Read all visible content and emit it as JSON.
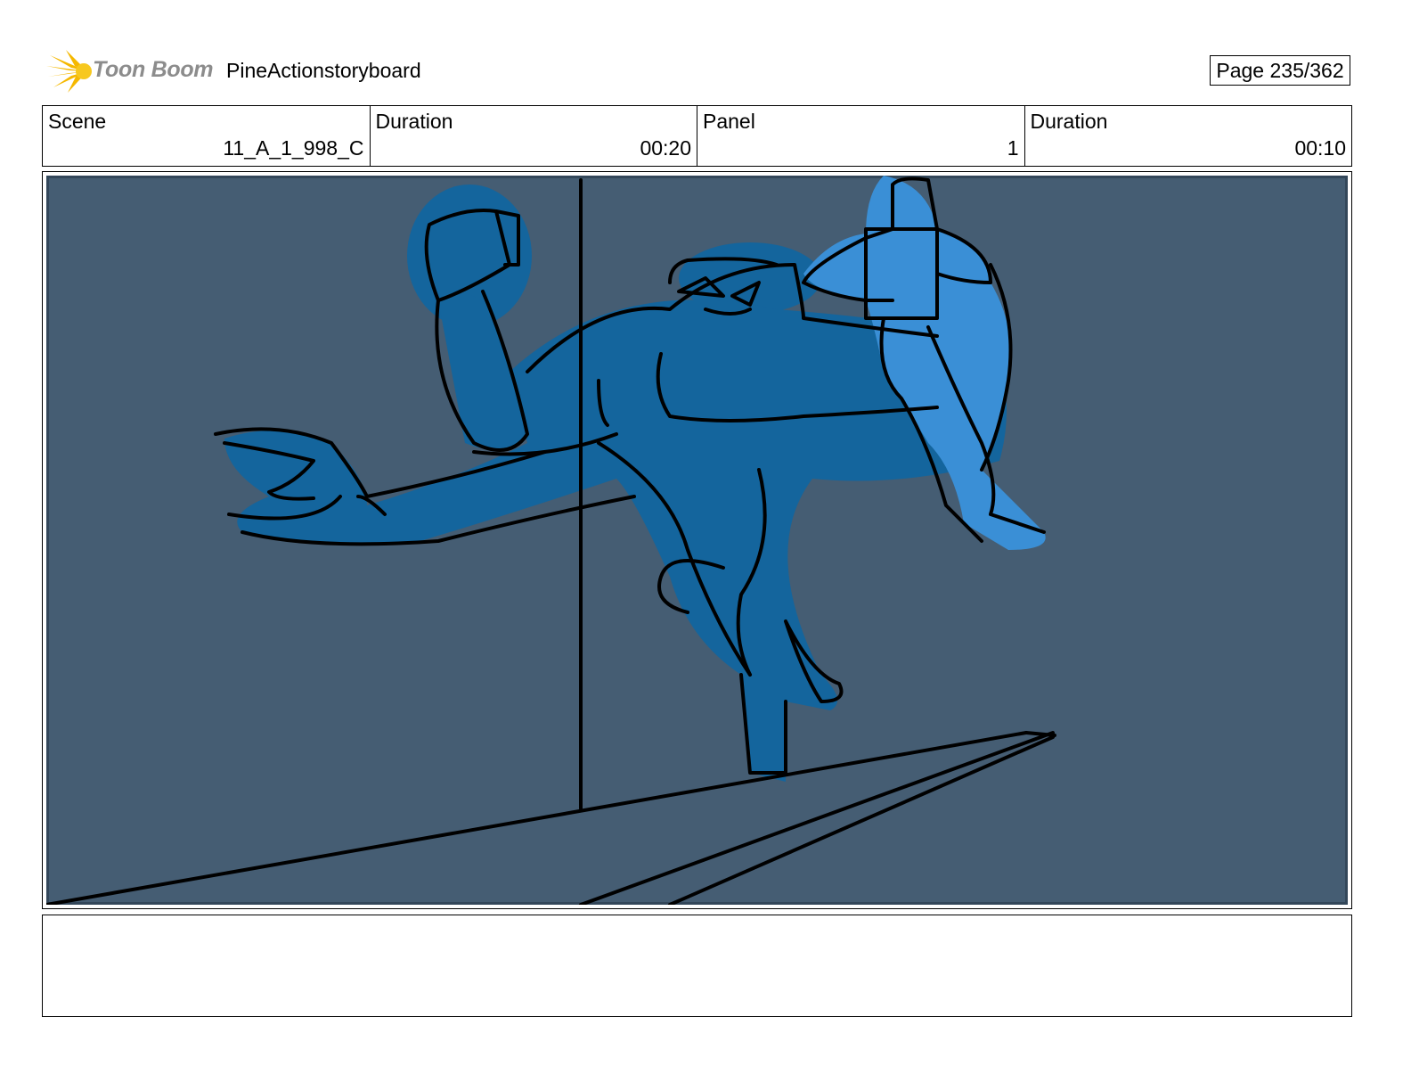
{
  "header": {
    "logo_text": "Toon Boom",
    "project_title": "PineActionstoryboard",
    "page_indicator": "Page 235/362"
  },
  "info": {
    "scene_label": "Scene",
    "scene_value": "11_A_1_998_C",
    "scene_duration_label": "Duration",
    "scene_duration_value": "00:20",
    "panel_label": "Panel",
    "panel_value": "1",
    "panel_duration_label": "Duration",
    "panel_duration_value": "00:10"
  },
  "panel": {
    "background_color": "#455d73",
    "figure_color": "#14659d",
    "small_figure_color": "#3a8fd6",
    "line_color": "#000000"
  },
  "notes": {
    "text": ""
  }
}
